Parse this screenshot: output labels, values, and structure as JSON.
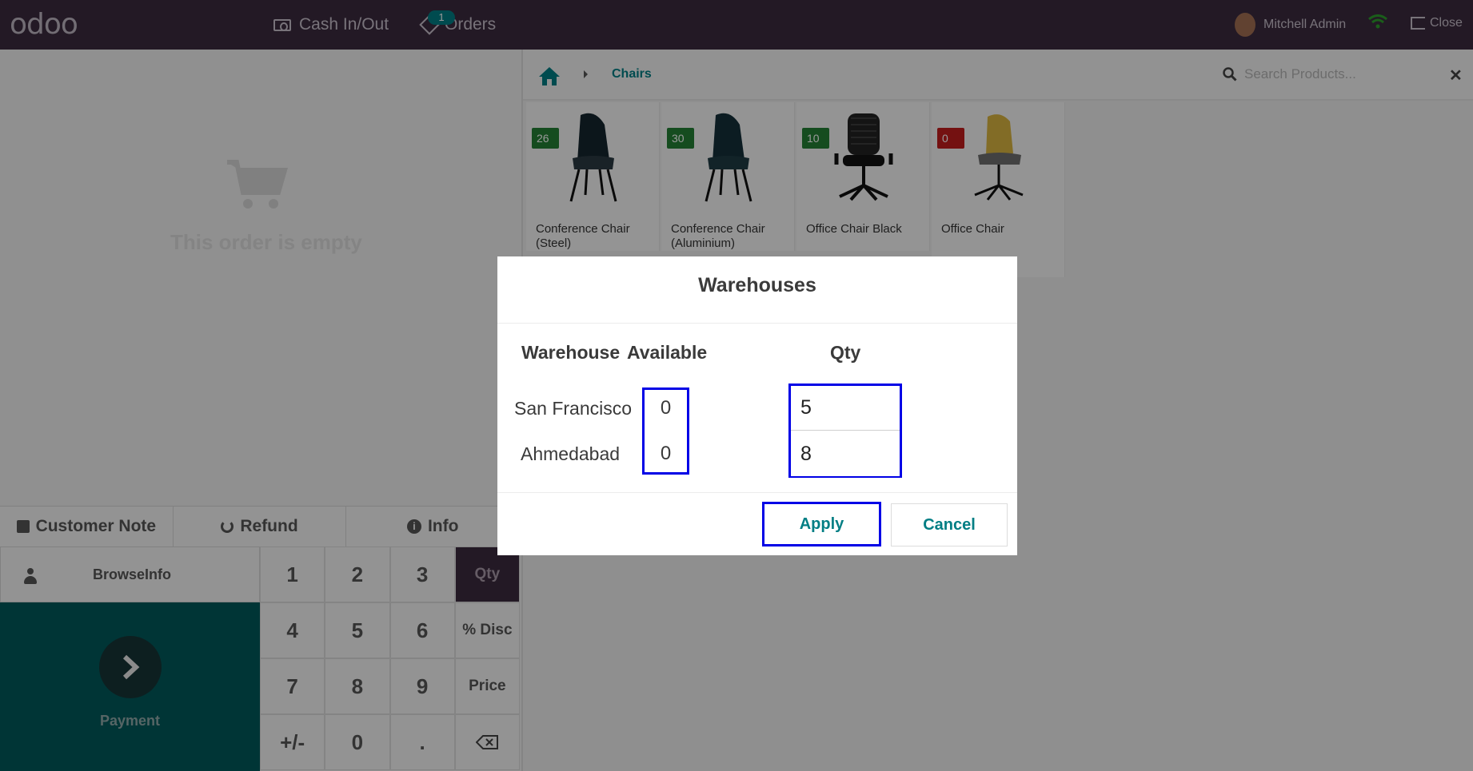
{
  "header": {
    "logo": "odoo",
    "cash_label": "Cash In/Out",
    "orders_label": "Orders",
    "orders_badge": "1",
    "user_name": "Mitchell Admin",
    "close_label": "Close"
  },
  "order": {
    "empty_text": "This order is empty"
  },
  "controls": {
    "customer_note": "Customer Note",
    "refund": "Refund",
    "info": "Info",
    "customer": "BrowseInfo",
    "payment": "Payment"
  },
  "numpad": {
    "keys": [
      "1",
      "2",
      "3",
      "Qty",
      "4",
      "5",
      "6",
      "% Disc",
      "7",
      "8",
      "9",
      "Price",
      "+/-",
      "0",
      "."
    ],
    "active_mode": "Qty"
  },
  "products_panel": {
    "breadcrumb": "Chairs",
    "search_placeholder": "Search Products...",
    "items": [
      {
        "name": "Conference Chair (Steel)",
        "stock": "26",
        "stock_status": "green"
      },
      {
        "name": "Conference Chair (Aluminium)",
        "stock": "30",
        "stock_status": "green"
      },
      {
        "name": "Office Chair Black",
        "stock": "10",
        "stock_status": "green"
      },
      {
        "name": "Office Chair",
        "stock": "0",
        "stock_status": "red"
      }
    ]
  },
  "dialog": {
    "title": "Warehouses",
    "col_warehouse": "Warehouse",
    "col_available": "Available",
    "col_qty": "Qty",
    "rows": [
      {
        "warehouse": "San Francisco",
        "available": "0",
        "qty": "5"
      },
      {
        "warehouse": "Ahmedabad",
        "available": "0",
        "qty": "8"
      }
    ],
    "apply_label": "Apply",
    "cancel_label": "Cancel"
  },
  "colors": {
    "topbar": "#3b2a3f",
    "accent": "#017e84",
    "payment": "#00595b",
    "highlight": "#0000e6"
  }
}
